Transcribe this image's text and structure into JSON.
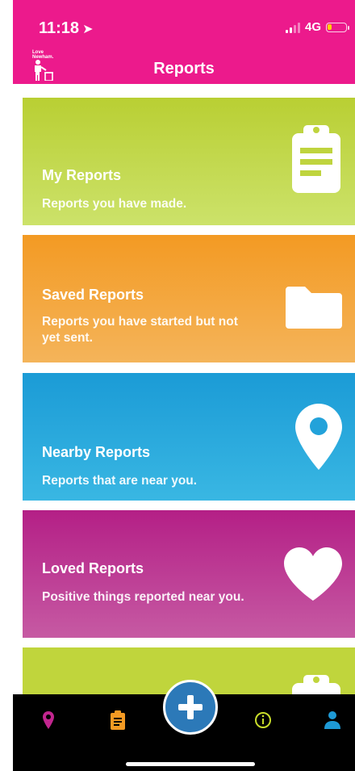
{
  "status": {
    "time": "11:18",
    "network": "4G"
  },
  "header": {
    "title": "Reports",
    "logo_text_1": "Love",
    "logo_text_2": "Newham."
  },
  "cards": [
    {
      "title": "My Reports",
      "subtitle": "Reports you have made."
    },
    {
      "title": "Saved Reports",
      "subtitle": "Reports you have started but not yet sent."
    },
    {
      "title": "Nearby Reports",
      "subtitle": "Reports that are near you."
    },
    {
      "title": "Loved Reports",
      "subtitle": "Positive things reported near you."
    }
  ],
  "tabbar": {
    "items": [
      "map-pin-icon",
      "clipboard-icon",
      "plus-icon",
      "info-icon",
      "user-icon"
    ]
  },
  "colors": {
    "header": "#ec1a8c",
    "my_reports": "#b9cf33",
    "saved_reports": "#f39a23",
    "nearby_reports": "#1b9bd6",
    "loved_reports": "#b41f86",
    "tab_map": "#c2268f",
    "tab_reports": "#f39a23",
    "tab_add": "#2c79b8",
    "tab_info": "#c8dc2a",
    "tab_user": "#1e9ad6"
  }
}
